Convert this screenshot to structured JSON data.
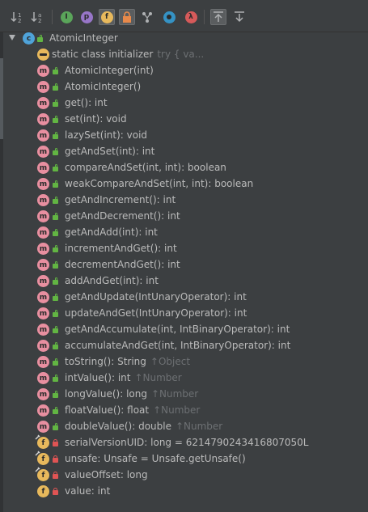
{
  "toolbar": {
    "buttons": [
      {
        "name": "sort-by-visibility-icon",
        "glyph": "↓₁",
        "active": false
      },
      {
        "name": "sort-alphabetically-icon",
        "glyph": "↓ᵃ",
        "active": false
      },
      {
        "name": "show-inherited-icon",
        "glyph": "I",
        "color": "#5aa55a",
        "active": false
      },
      {
        "name": "show-properties-icon",
        "glyph": "p",
        "color": "#9876c8",
        "active": false
      },
      {
        "name": "show-fields-icon",
        "glyph": "f",
        "color": "#e8b95c",
        "active": true
      },
      {
        "name": "show-non-public-icon",
        "glyph": "🔒",
        "active": true
      },
      {
        "name": "show-anonymous-icon",
        "glyph": "Y",
        "active": false
      },
      {
        "name": "show-lambdas-icon",
        "glyph": "●",
        "color": "#3592c4",
        "active": false
      },
      {
        "name": "show-lambda-icon",
        "glyph": "λ",
        "color": "#d65a5a",
        "active": false
      },
      {
        "name": "autoscroll-to-source-icon",
        "glyph": "⤒",
        "active": true
      },
      {
        "name": "autoscroll-from-source-icon",
        "glyph": "⤓",
        "active": false
      }
    ]
  },
  "tree": {
    "root": {
      "label": "AtomicInteger",
      "kind": "c"
    },
    "items": [
      {
        "kind": "i",
        "vis": "none",
        "name": "static class initializer",
        "sig": "",
        "dim": "try {                  va..."
      },
      {
        "kind": "m",
        "vis": "pub",
        "name": "AtomicInteger(int)",
        "sig": "",
        "dim": ""
      },
      {
        "kind": "m",
        "vis": "pub",
        "name": "AtomicInteger()",
        "sig": "",
        "dim": ""
      },
      {
        "kind": "m",
        "vis": "pub",
        "name": "get(): int",
        "sig": "",
        "dim": ""
      },
      {
        "kind": "m",
        "vis": "pub",
        "name": "set(int): void",
        "sig": "",
        "dim": ""
      },
      {
        "kind": "m",
        "vis": "pub",
        "name": "lazySet(int): void",
        "sig": "",
        "dim": ""
      },
      {
        "kind": "m",
        "vis": "pub",
        "name": "getAndSet(int): int",
        "sig": "",
        "dim": ""
      },
      {
        "kind": "m",
        "vis": "pub",
        "name": "compareAndSet(int, int): boolean",
        "sig": "",
        "dim": ""
      },
      {
        "kind": "m",
        "vis": "pub",
        "name": "weakCompareAndSet(int, int): boolean",
        "sig": "",
        "dim": ""
      },
      {
        "kind": "m",
        "vis": "pub",
        "name": "getAndIncrement(): int",
        "sig": "",
        "dim": ""
      },
      {
        "kind": "m",
        "vis": "pub",
        "name": "getAndDecrement(): int",
        "sig": "",
        "dim": ""
      },
      {
        "kind": "m",
        "vis": "pub",
        "name": "getAndAdd(int): int",
        "sig": "",
        "dim": ""
      },
      {
        "kind": "m",
        "vis": "pub",
        "name": "incrementAndGet(): int",
        "sig": "",
        "dim": ""
      },
      {
        "kind": "m",
        "vis": "pub",
        "name": "decrementAndGet(): int",
        "sig": "",
        "dim": ""
      },
      {
        "kind": "m",
        "vis": "pub",
        "name": "addAndGet(int): int",
        "sig": "",
        "dim": ""
      },
      {
        "kind": "m",
        "vis": "pub",
        "name": "getAndUpdate(IntUnaryOperator): int",
        "sig": "",
        "dim": ""
      },
      {
        "kind": "m",
        "vis": "pub",
        "name": "updateAndGet(IntUnaryOperator): int",
        "sig": "",
        "dim": ""
      },
      {
        "kind": "m",
        "vis": "pub",
        "name": "getAndAccumulate(int, IntBinaryOperator): int",
        "sig": "",
        "dim": ""
      },
      {
        "kind": "m",
        "vis": "pub",
        "name": "accumulateAndGet(int, IntBinaryOperator): int",
        "sig": "",
        "dim": ""
      },
      {
        "kind": "m",
        "vis": "pub",
        "name": "toString(): String",
        "sig": "",
        "dim": "↑Object"
      },
      {
        "kind": "m",
        "vis": "pub",
        "name": "intValue(): int",
        "sig": "",
        "dim": "↑Number"
      },
      {
        "kind": "m",
        "vis": "pub",
        "name": "longValue(): long",
        "sig": "",
        "dim": "↑Number"
      },
      {
        "kind": "m",
        "vis": "pub",
        "name": "floatValue(): float",
        "sig": "",
        "dim": "↑Number"
      },
      {
        "kind": "m",
        "vis": "pub",
        "name": "doubleValue(): double",
        "sig": "",
        "dim": "↑Number"
      },
      {
        "kind": "f",
        "vis": "priv",
        "pinned": true,
        "name": "serialVersionUID: long = 6214790243416807050L",
        "sig": "",
        "dim": ""
      },
      {
        "kind": "f",
        "vis": "priv",
        "pinned": true,
        "name": "unsafe: Unsafe = Unsafe.getUnsafe()",
        "sig": "",
        "dim": ""
      },
      {
        "kind": "f",
        "vis": "priv",
        "pinned": true,
        "name": "valueOffset: long",
        "sig": "",
        "dim": ""
      },
      {
        "kind": "f",
        "vis": "priv",
        "pinned": false,
        "name": "value: int",
        "sig": "",
        "dim": ""
      }
    ]
  }
}
